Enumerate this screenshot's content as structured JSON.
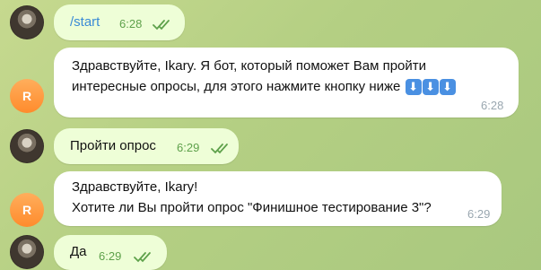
{
  "messages": [
    {
      "text": "/start",
      "time": "6:28",
      "direction": "out"
    },
    {
      "lines": [
        "Здравствуйте, Ikary. Я бот, который поможет Вам пройти",
        "интересные опросы, для этого нажмите кнопку ниже"
      ],
      "emoji": [
        "⬇",
        "⬇",
        "⬇"
      ],
      "time": "6:28",
      "direction": "in",
      "avatar_letter": "R"
    },
    {
      "text": "Пройти опрос",
      "time": "6:29",
      "direction": "out"
    },
    {
      "lines": [
        "Здравствуйте, Ikary!",
        "Хотите ли Вы пройти опрос \"Финишное тестирование 3\"?"
      ],
      "time": "6:29",
      "direction": "in",
      "avatar_letter": "R"
    },
    {
      "text": "Да",
      "time": "6:29",
      "direction": "out"
    }
  ],
  "colors": {
    "outgoing_bubble": "#eefed7",
    "incoming_bubble": "#ffffff",
    "link": "#3a8bd6",
    "read_check": "#5ea14b",
    "bot_avatar": "#ff8b2c"
  }
}
